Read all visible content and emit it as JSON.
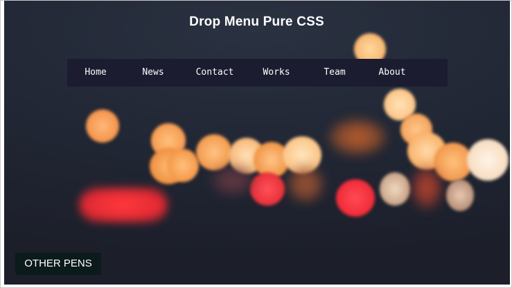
{
  "page": {
    "title": "Drop Menu Pure CSS"
  },
  "menu": {
    "items": [
      {
        "label": "Home"
      },
      {
        "label": "News"
      },
      {
        "label": "Contact"
      },
      {
        "label": "Works"
      },
      {
        "label": "Team"
      },
      {
        "label": "About"
      }
    ]
  },
  "footer": {
    "other_pens_label": "OTHER PENS"
  },
  "colors": {
    "menu_background": "#1b1c30",
    "page_background": "#222836",
    "button_background": "#0b1a1a",
    "bokeh_orange": "#ffb066",
    "bokeh_red": "#ff3038"
  }
}
